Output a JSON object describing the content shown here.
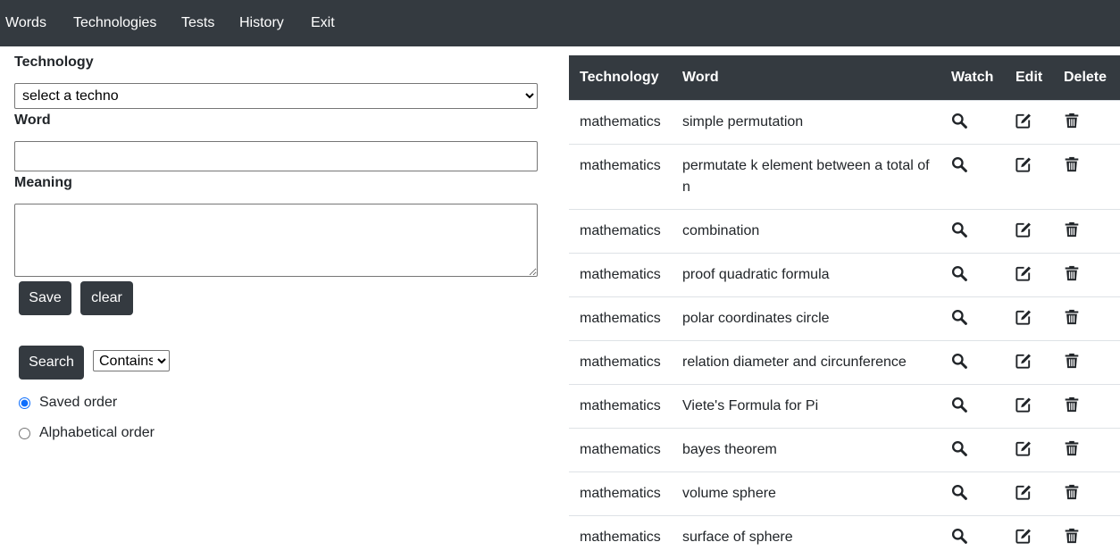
{
  "nav": {
    "items": [
      "Words",
      "Technologies",
      "Tests",
      "History",
      "Exit"
    ]
  },
  "form": {
    "technology_label": "Technology",
    "technology_select": "select a techno",
    "word_label": "Word",
    "word_value": "",
    "meaning_label": "Meaning",
    "meaning_value": "",
    "save_label": "Save",
    "clear_label": "clear"
  },
  "search": {
    "button_label": "Search",
    "mode_select": "Contains",
    "orders": [
      {
        "label": "Saved order",
        "checked": true
      },
      {
        "label": "Alphabetical order",
        "checked": false
      }
    ]
  },
  "table": {
    "headers": {
      "technology": "Technology",
      "word": "Word",
      "watch": "Watch",
      "edit": "Edit",
      "delete": "Delete"
    },
    "rows": [
      {
        "technology": "mathematics",
        "word": "simple permutation"
      },
      {
        "technology": "mathematics",
        "word": "permutate k element between a total of n"
      },
      {
        "technology": "mathematics",
        "word": "combination"
      },
      {
        "technology": "mathematics",
        "word": "proof quadratic formula"
      },
      {
        "technology": "mathematics",
        "word": "polar coordinates circle"
      },
      {
        "technology": "mathematics",
        "word": "relation diameter and circunference"
      },
      {
        "technology": "mathematics",
        "word": "Viete's Formula for Pi"
      },
      {
        "technology": "mathematics",
        "word": "bayes theorem"
      },
      {
        "technology": "mathematics",
        "word": "volume sphere"
      },
      {
        "technology": "mathematics",
        "word": "surface of sphere"
      }
    ]
  },
  "icons": {
    "watch": "search-icon",
    "edit": "edit-icon",
    "delete": "trash-icon"
  },
  "colors": {
    "dark": "#343a40",
    "border": "#dee2e6",
    "radio_accent": "#0d6efd"
  }
}
